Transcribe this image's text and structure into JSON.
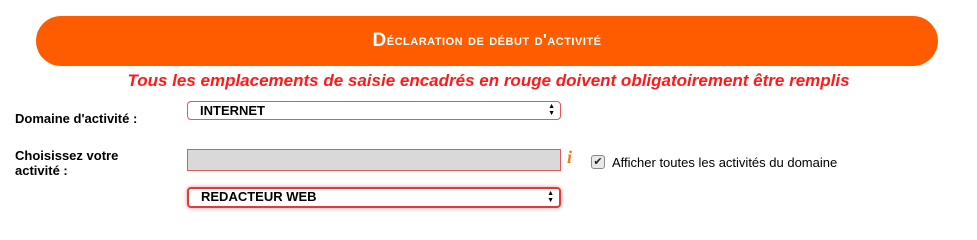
{
  "header": {
    "title_initial": "D",
    "title_rest": "éclaration de début d'activité"
  },
  "notice": {
    "text": "Tous les emplacements de saisie encadrés en rouge doivent obligatoirement être remplis"
  },
  "form": {
    "domain": {
      "label": "Domaine d'activité :",
      "selected": "INTERNET"
    },
    "activity": {
      "label_line1": "Choisissez votre",
      "label_line2": "activité :",
      "input_value": "",
      "info_icon": "i",
      "show_all_checkbox_checked": true,
      "show_all_label": "Afficher toutes les activités du domaine",
      "selected": "REDACTEUR WEB"
    }
  },
  "colors": {
    "banner": "#ff5c00",
    "notice": "#ff1a1a",
    "required_border": "#e85656",
    "info_icon": "#f07d1b"
  }
}
